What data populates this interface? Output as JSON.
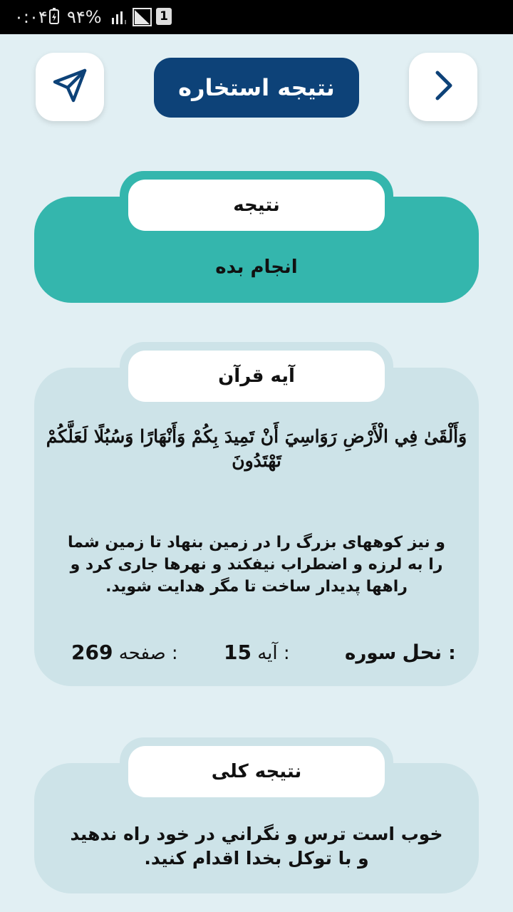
{
  "status_bar": {
    "time": "۰:۰۴",
    "battery": "۹۴%",
    "sim": "1"
  },
  "header": {
    "title": "نتیجه استخاره",
    "share_icon": "send-icon",
    "back_icon": "chevron-right-icon"
  },
  "result": {
    "label": "نتیجه",
    "value": "انجام بده"
  },
  "verse": {
    "label": "آیه قرآن",
    "arabic": "وَأَلْقَىٰ فِي الْأَرْضِ رَوَاسِيَ أَنْ تَمِيدَ بِكُمْ وَأَنْهَارًا وَسُبُلًا لَعَلَّكُمْ تَهْتَدُونَ",
    "translation": "و نیز کوههای بزرگ را در زمین بنهاد تا زمین شما را به لرزه و اضطراب نیفکند و نهرها جاری کرد و راهها پدیدار ساخت تا مگر هدایت شوید.",
    "surah_label": "سوره :",
    "surah_value": "نحل",
    "ayah_label": "آیه :",
    "ayah_value": "15",
    "page_label": "صفحه :",
    "page_value": "269"
  },
  "summary": {
    "label": "نتیجه کلی",
    "text": "خوب است ترس و نگراني در خود راه ندهید و با توکل بخدا اقدام کنید."
  },
  "colors": {
    "background": "#e1eff3",
    "title_bg": "#0d4278",
    "result_card": "#34b6ad",
    "pale_card": "#cde3e8",
    "icon": "#0d4278"
  }
}
